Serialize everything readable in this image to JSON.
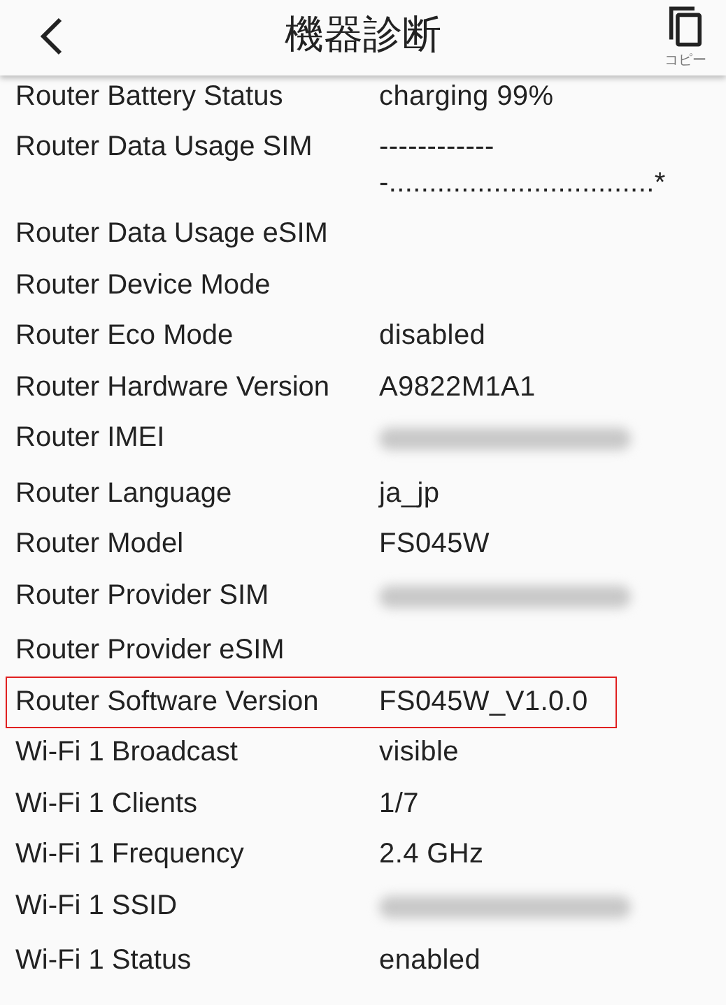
{
  "header": {
    "title": "機器診断",
    "copy_label": "コピー"
  },
  "rows": [
    {
      "label": "Router Battery Status",
      "value": "charging 99%",
      "highlighted": false
    },
    {
      "label": "Router Data Usage SIM",
      "value": "-------------.................................*",
      "highlighted": false
    },
    {
      "label": "Router Data Usage eSIM",
      "highlighted": false
    },
    {
      "label": "Router Device Mode",
      "highlighted": false
    },
    {
      "label": "Router Eco Mode",
      "value": "disabled",
      "highlighted": false
    },
    {
      "label": "Router Hardware Version",
      "value": "A9822M1A1",
      "highlighted": false
    },
    {
      "label": "Router IMEI",
      "redacted": true,
      "highlighted": false
    },
    {
      "label": "Router Language",
      "value": "ja_jp",
      "highlighted": false
    },
    {
      "label": "Router Model",
      "value": "FS045W",
      "highlighted": false
    },
    {
      "label": "Router Provider SIM",
      "redacted": true,
      "highlighted": false
    },
    {
      "label": "Router Provider eSIM",
      "highlighted": false
    },
    {
      "label": "Router Software Version",
      "value": "FS045W_V1.0.0",
      "highlighted": true
    },
    {
      "label": "Wi-Fi 1 Broadcast",
      "value": "visible",
      "highlighted": false
    },
    {
      "label": "Wi-Fi 1 Clients",
      "value": "1/7",
      "highlighted": false
    },
    {
      "label": "Wi-Fi 1 Frequency",
      "value": "2.4 GHz",
      "highlighted": false
    },
    {
      "label": "Wi-Fi 1 SSID",
      "redacted": true,
      "highlighted": false
    },
    {
      "label": "Wi-Fi 1 Status",
      "value": "enabled",
      "highlighted": false
    }
  ]
}
